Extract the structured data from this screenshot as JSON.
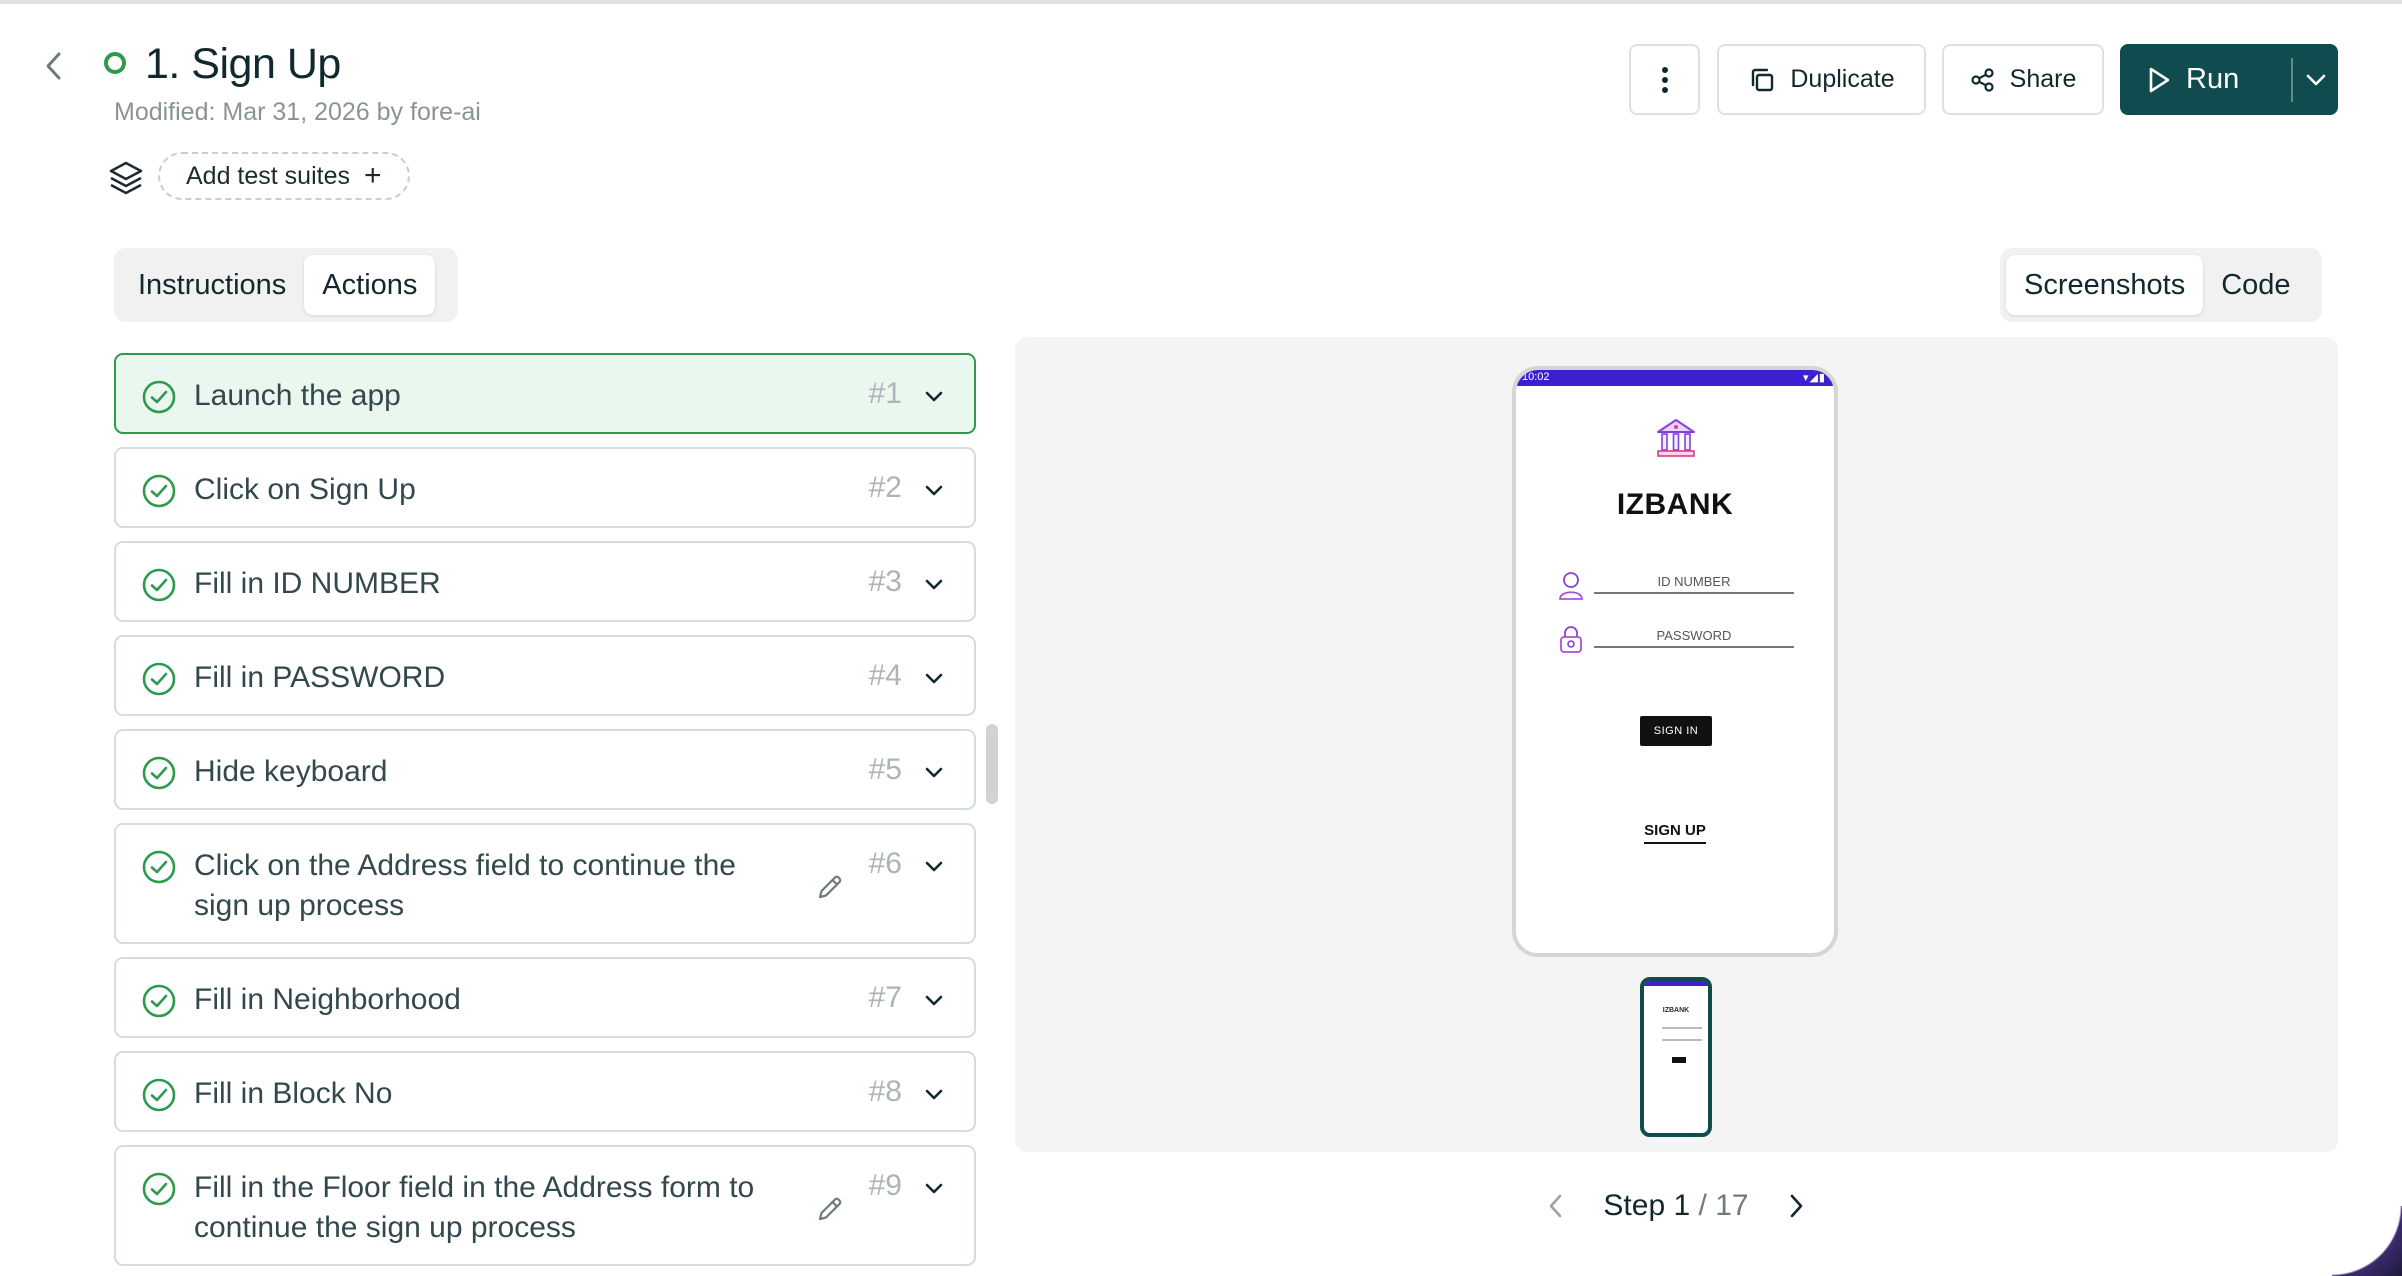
{
  "header": {
    "title": "1. Sign Up",
    "modified": "Modified: Mar 31, 2026 by fore-ai",
    "add_suites_label": "Add test suites",
    "add_suites_plus": "+",
    "duplicate_label": "Duplicate",
    "share_label": "Share",
    "run_label": "Run"
  },
  "left_tabs": [
    {
      "label": "Instructions",
      "active": false
    },
    {
      "label": "Actions",
      "active": true
    }
  ],
  "right_tabs": [
    {
      "label": "Screenshots",
      "active": true
    },
    {
      "label": "Code",
      "active": false
    }
  ],
  "actions": [
    {
      "label": "Launch the app",
      "num": "#1",
      "active": true
    },
    {
      "label": "Click on Sign Up",
      "num": "#2"
    },
    {
      "label": "Fill in ID NUMBER",
      "num": "#3"
    },
    {
      "label": "Fill in PASSWORD",
      "num": "#4"
    },
    {
      "label": "Hide keyboard",
      "num": "#5"
    },
    {
      "label_line1": "Click on the Address field to continue the",
      "label_line2": "sign up process",
      "num": "#6",
      "editable": true
    },
    {
      "label": "Fill in Neighborhood",
      "num": "#7"
    },
    {
      "label": "Fill in Block No",
      "num": "#8"
    },
    {
      "label_line1": "Fill in the Floor field in the Address form to",
      "label_line2": "continue the sign up process",
      "num": "#9",
      "editable": true
    }
  ],
  "phone": {
    "status_time": "10:02",
    "status_icons": "▾◢▮",
    "app_name": "IZBANK",
    "id_placeholder": "ID NUMBER",
    "password_placeholder": "PASSWORD",
    "signin_label": "SIGN IN",
    "signup_label": "SIGN UP"
  },
  "thumbnail": {
    "app_name": "IZBANK"
  },
  "stepper": {
    "prefix": "Step ",
    "current": "1",
    "separator": " / ",
    "total": "17"
  },
  "colors": {
    "brand": "#0f4b4f",
    "success": "#2e9a4e",
    "status_bar": "#3c1fd0"
  }
}
